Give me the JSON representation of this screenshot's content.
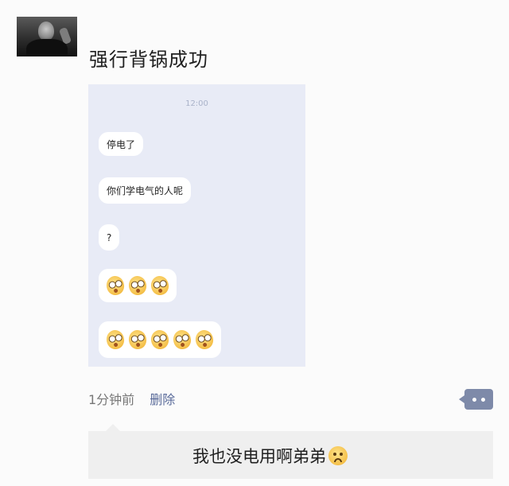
{
  "post": {
    "avatar_icon": "user-avatar-photo",
    "title": "强行背锅成功",
    "screenshot": {
      "time": "12:00",
      "messages": [
        {
          "text": "停电了"
        },
        {
          "text": "你们学电气的人呢"
        },
        {
          "text": "?"
        },
        {
          "emoji": "shocked-face-icon",
          "count": 3
        },
        {
          "emoji": "shocked-face-icon",
          "count": 5
        }
      ]
    },
    "meta": {
      "time_ago": "1分钟前",
      "delete_label": "删除",
      "comment_icon": "comment-icon"
    }
  },
  "reply": {
    "text": "我也没电用啊弟弟",
    "emoji": "sad-face-icon"
  }
}
